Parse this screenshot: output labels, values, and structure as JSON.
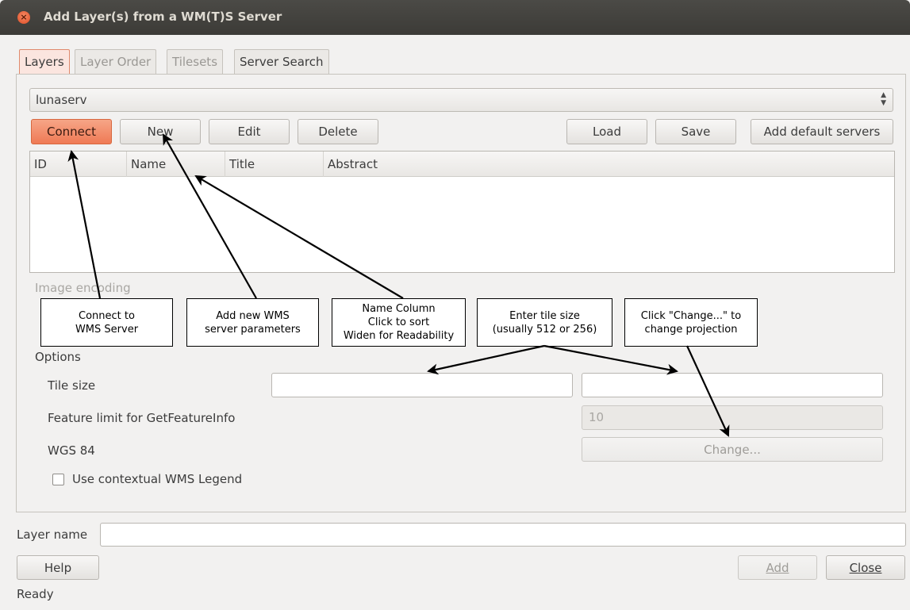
{
  "window": {
    "title": "Add Layer(s) from a WM(T)S Server",
    "close_glyph": "×"
  },
  "tabs": [
    {
      "label": "Layers"
    },
    {
      "label": "Layer Order"
    },
    {
      "label": "Tilesets"
    },
    {
      "label": "Server Search"
    }
  ],
  "server_select": {
    "value": "lunaserv",
    "arrows": "▲▼"
  },
  "buttons": {
    "connect": "Connect",
    "new": "New",
    "edit": "Edit",
    "delete": "Delete",
    "load": "Load",
    "save": "Save",
    "add_default": "Add default servers",
    "help": "Help",
    "add": "Add",
    "close": "Close",
    "change": "Change..."
  },
  "table": {
    "columns": [
      "ID",
      "Name",
      "Title",
      "Abstract"
    ]
  },
  "image_encoding_label": "Image encoding",
  "options": {
    "heading": "Options",
    "tile_size_label": "Tile size",
    "feature_limit_label": "Feature limit for GetFeatureInfo",
    "feature_limit_value": "10",
    "crs_label": "WGS 84",
    "contextual_legend_label": "Use contextual WMS Legend"
  },
  "layer_name_label": "Layer name",
  "status": "Ready",
  "annotations": {
    "connect": [
      "Connect to",
      "WMS Server"
    ],
    "new": [
      "Add new WMS",
      "server parameters"
    ],
    "name_column": [
      "Name Column",
      "Click to sort",
      "Widen for Readability"
    ],
    "tile_size": [
      "Enter tile size",
      "(usually 512 or 256)"
    ],
    "change": [
      "Click \"Change...\" to",
      "change projection"
    ]
  }
}
